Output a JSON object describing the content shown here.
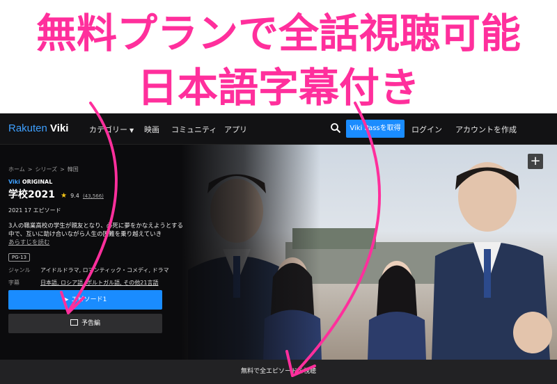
{
  "caption": {
    "line1": "無料プランで全話視聴可能",
    "line2": "日本語字幕付き"
  },
  "nav": {
    "logo_brand": "Rakuten",
    "logo_product": "Viki",
    "items": [
      "カテゴリー",
      "映画",
      "コミュニティ",
      "アプリ"
    ],
    "search_icon": "search-icon",
    "viki_pass_button": "Viki Passを取得",
    "login": "ログイン",
    "signup": "アカウントを作成"
  },
  "breadcrumb": [
    "ホーム",
    ">",
    "シリーズ",
    ">",
    "韓国"
  ],
  "show": {
    "badge_brand": "Viki",
    "badge_label": "ORIGINAL",
    "title": "学校2021",
    "rating": "9.4",
    "rating_count": "(43,566)",
    "year": "2021",
    "episodes": "17 エピソード",
    "description": "3人の職業高校の学生が親友となり、必死に夢をかなえようとする中で、互いに助け合いながら人生の困難を乗り越えていき",
    "more_link": "あらすじを読む",
    "age_rating": "PG-13",
    "genre_label": "ジャンル",
    "genre_value": "アイドルドラマ, ロマンティック・コメディ, ドラマ",
    "subtitle_label": "字幕",
    "subtitle_value": "日本語, ロシア語, ポルトガル語, ",
    "subtitle_more": "その他21言語"
  },
  "buttons": {
    "episode": "エピソード1",
    "trailer": "予告編",
    "plus": "+"
  },
  "bottom_bar": "無料で全エピソードを視聴",
  "colors": {
    "caption": "#ff2f9c",
    "accent": "#1a8cff",
    "star": "#f5c518"
  }
}
